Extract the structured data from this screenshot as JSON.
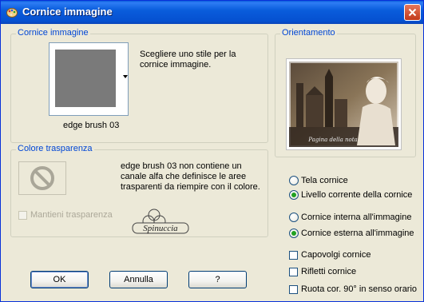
{
  "window": {
    "title": "Cornice immagine",
    "title_icon": "paint-palette-icon",
    "close_icon": "close-icon"
  },
  "frame_group": {
    "legend": "Cornice immagine",
    "description_line1": "Scegliere uno stile per la",
    "description_line2": "cornice immagine.",
    "frame_name": "edge brush 03"
  },
  "transparency_group": {
    "legend": "Colore trasparenza",
    "message_line1": "edge brush 03 non contiene un",
    "message_line2": "canale alfa che definisce le aree",
    "message_line3": "trasparenti da riempire con il colore.",
    "keep_label": "Mantieni trasparenza",
    "watermark": "Spinuccia"
  },
  "orientation_group": {
    "legend": "Orientamento",
    "preview_caption": "Pagina della nota"
  },
  "options": {
    "tela_cornice": "Tela cornice",
    "livello_corrente": "Livello corrente della cornice",
    "cornice_interna": "Cornice interna all'immagine",
    "cornice_esterna": "Cornice esterna all'immagine",
    "capovolgi": "Capovolgi cornice",
    "rifletti": "Rifletti cornice",
    "ruota": "Ruota cor. 90° in senso orario"
  },
  "buttons": {
    "ok": "OK",
    "annulla": "Annulla",
    "help": "?"
  }
}
